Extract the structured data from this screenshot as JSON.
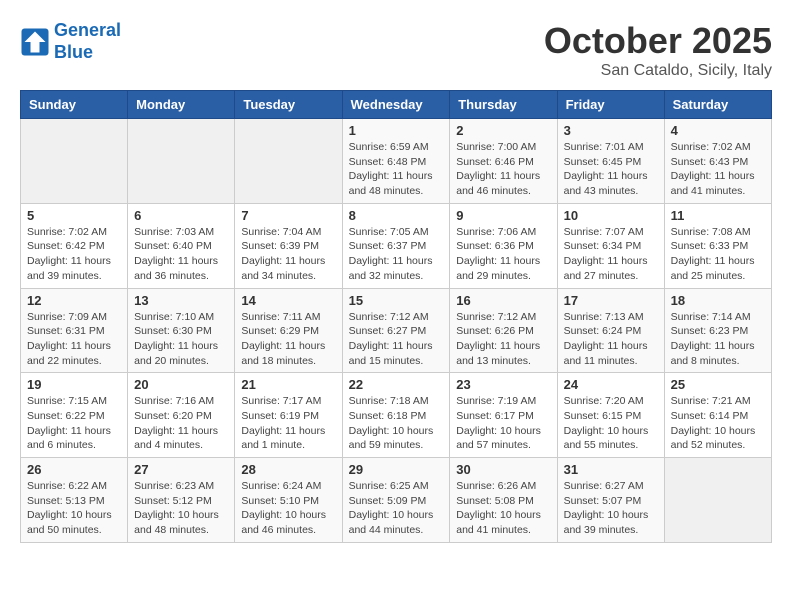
{
  "header": {
    "logo_line1": "General",
    "logo_line2": "Blue",
    "month": "October 2025",
    "location": "San Cataldo, Sicily, Italy"
  },
  "days_of_week": [
    "Sunday",
    "Monday",
    "Tuesday",
    "Wednesday",
    "Thursday",
    "Friday",
    "Saturday"
  ],
  "weeks": [
    [
      {
        "day": "",
        "info": ""
      },
      {
        "day": "",
        "info": ""
      },
      {
        "day": "",
        "info": ""
      },
      {
        "day": "1",
        "info": "Sunrise: 6:59 AM\nSunset: 6:48 PM\nDaylight: 11 hours and 48 minutes."
      },
      {
        "day": "2",
        "info": "Sunrise: 7:00 AM\nSunset: 6:46 PM\nDaylight: 11 hours and 46 minutes."
      },
      {
        "day": "3",
        "info": "Sunrise: 7:01 AM\nSunset: 6:45 PM\nDaylight: 11 hours and 43 minutes."
      },
      {
        "day": "4",
        "info": "Sunrise: 7:02 AM\nSunset: 6:43 PM\nDaylight: 11 hours and 41 minutes."
      }
    ],
    [
      {
        "day": "5",
        "info": "Sunrise: 7:02 AM\nSunset: 6:42 PM\nDaylight: 11 hours and 39 minutes."
      },
      {
        "day": "6",
        "info": "Sunrise: 7:03 AM\nSunset: 6:40 PM\nDaylight: 11 hours and 36 minutes."
      },
      {
        "day": "7",
        "info": "Sunrise: 7:04 AM\nSunset: 6:39 PM\nDaylight: 11 hours and 34 minutes."
      },
      {
        "day": "8",
        "info": "Sunrise: 7:05 AM\nSunset: 6:37 PM\nDaylight: 11 hours and 32 minutes."
      },
      {
        "day": "9",
        "info": "Sunrise: 7:06 AM\nSunset: 6:36 PM\nDaylight: 11 hours and 29 minutes."
      },
      {
        "day": "10",
        "info": "Sunrise: 7:07 AM\nSunset: 6:34 PM\nDaylight: 11 hours and 27 minutes."
      },
      {
        "day": "11",
        "info": "Sunrise: 7:08 AM\nSunset: 6:33 PM\nDaylight: 11 hours and 25 minutes."
      }
    ],
    [
      {
        "day": "12",
        "info": "Sunrise: 7:09 AM\nSunset: 6:31 PM\nDaylight: 11 hours and 22 minutes."
      },
      {
        "day": "13",
        "info": "Sunrise: 7:10 AM\nSunset: 6:30 PM\nDaylight: 11 hours and 20 minutes."
      },
      {
        "day": "14",
        "info": "Sunrise: 7:11 AM\nSunset: 6:29 PM\nDaylight: 11 hours and 18 minutes."
      },
      {
        "day": "15",
        "info": "Sunrise: 7:12 AM\nSunset: 6:27 PM\nDaylight: 11 hours and 15 minutes."
      },
      {
        "day": "16",
        "info": "Sunrise: 7:12 AM\nSunset: 6:26 PM\nDaylight: 11 hours and 13 minutes."
      },
      {
        "day": "17",
        "info": "Sunrise: 7:13 AM\nSunset: 6:24 PM\nDaylight: 11 hours and 11 minutes."
      },
      {
        "day": "18",
        "info": "Sunrise: 7:14 AM\nSunset: 6:23 PM\nDaylight: 11 hours and 8 minutes."
      }
    ],
    [
      {
        "day": "19",
        "info": "Sunrise: 7:15 AM\nSunset: 6:22 PM\nDaylight: 11 hours and 6 minutes."
      },
      {
        "day": "20",
        "info": "Sunrise: 7:16 AM\nSunset: 6:20 PM\nDaylight: 11 hours and 4 minutes."
      },
      {
        "day": "21",
        "info": "Sunrise: 7:17 AM\nSunset: 6:19 PM\nDaylight: 11 hours and 1 minute."
      },
      {
        "day": "22",
        "info": "Sunrise: 7:18 AM\nSunset: 6:18 PM\nDaylight: 10 hours and 59 minutes."
      },
      {
        "day": "23",
        "info": "Sunrise: 7:19 AM\nSunset: 6:17 PM\nDaylight: 10 hours and 57 minutes."
      },
      {
        "day": "24",
        "info": "Sunrise: 7:20 AM\nSunset: 6:15 PM\nDaylight: 10 hours and 55 minutes."
      },
      {
        "day": "25",
        "info": "Sunrise: 7:21 AM\nSunset: 6:14 PM\nDaylight: 10 hours and 52 minutes."
      }
    ],
    [
      {
        "day": "26",
        "info": "Sunrise: 6:22 AM\nSunset: 5:13 PM\nDaylight: 10 hours and 50 minutes."
      },
      {
        "day": "27",
        "info": "Sunrise: 6:23 AM\nSunset: 5:12 PM\nDaylight: 10 hours and 48 minutes."
      },
      {
        "day": "28",
        "info": "Sunrise: 6:24 AM\nSunset: 5:10 PM\nDaylight: 10 hours and 46 minutes."
      },
      {
        "day": "29",
        "info": "Sunrise: 6:25 AM\nSunset: 5:09 PM\nDaylight: 10 hours and 44 minutes."
      },
      {
        "day": "30",
        "info": "Sunrise: 6:26 AM\nSunset: 5:08 PM\nDaylight: 10 hours and 41 minutes."
      },
      {
        "day": "31",
        "info": "Sunrise: 6:27 AM\nSunset: 5:07 PM\nDaylight: 10 hours and 39 minutes."
      },
      {
        "day": "",
        "info": ""
      }
    ]
  ]
}
